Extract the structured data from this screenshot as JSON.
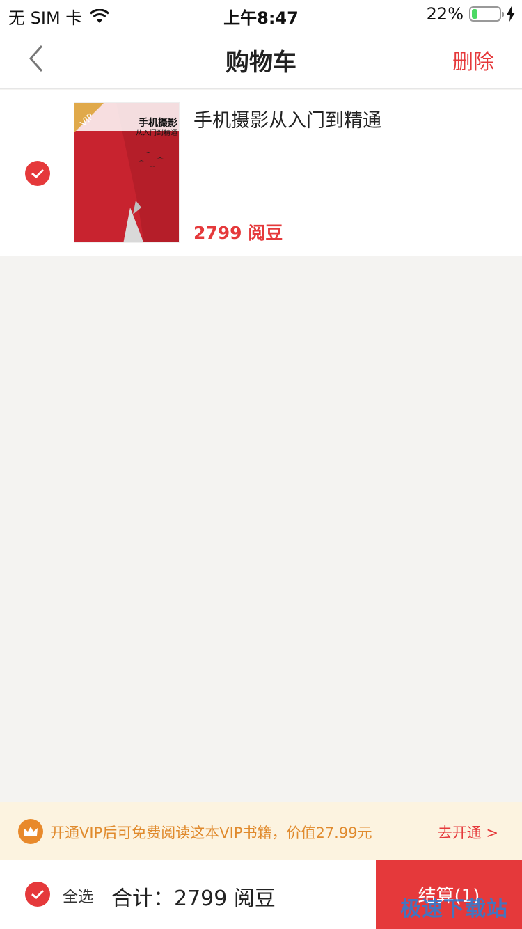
{
  "status_bar": {
    "carrier": "无 SIM 卡",
    "time": "上午8:47",
    "battery_percent": "22%",
    "battery_level": 0.22,
    "wifi_icon": "wifi-icon",
    "charging_icon": "bolt-icon"
  },
  "nav": {
    "title": "购物车",
    "delete_label": "删除",
    "back_icon": "chevron-left-icon"
  },
  "cart": {
    "items": [
      {
        "title": "手机摄影从入门到精通",
        "price": "2799 阅豆",
        "selected": true,
        "cover": {
          "badge": "VIP",
          "title": "手机摄影",
          "subtitle": "从入门到精通"
        }
      }
    ]
  },
  "vip_banner": {
    "text": "开通VIP后可免费阅读这本VIP书籍，价值27.99元",
    "link_label": "去开通 >",
    "icon": "crown-icon"
  },
  "bottom_bar": {
    "select_all_label": "全选",
    "total_label": "合计：2799 阅豆",
    "checkout_label": "结算(1)"
  },
  "watermark": "极速下载站",
  "colors": {
    "accent": "#e5393b",
    "background": "#f4f3f1",
    "vip_banner_bg": "#fcf3e0",
    "vip_text": "#e08a2d"
  }
}
